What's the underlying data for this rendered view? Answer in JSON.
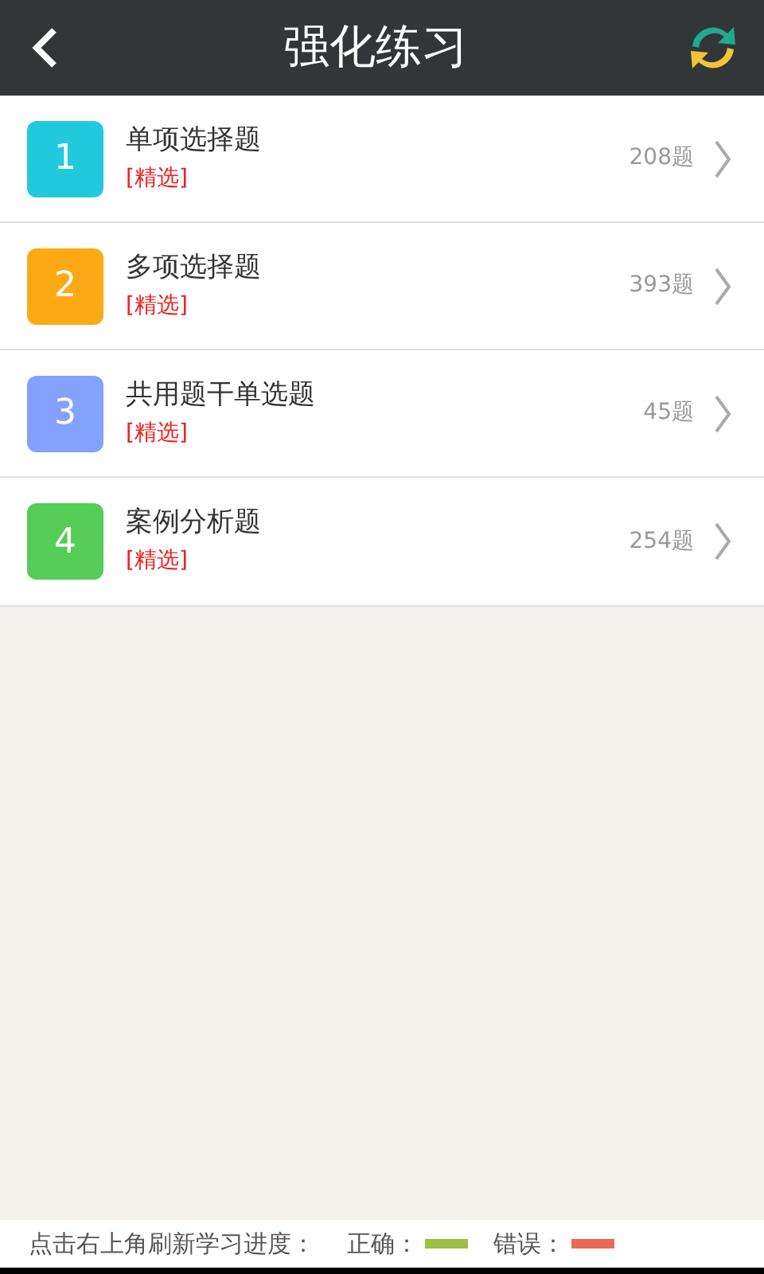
{
  "header": {
    "title": "强化练习"
  },
  "items": [
    {
      "number": "1",
      "title": "单项选择题",
      "tag": "[精选]",
      "count": "208题",
      "color": "#22c9dd"
    },
    {
      "number": "2",
      "title": "多项选择题",
      "tag": "[精选]",
      "count": "393题",
      "color": "#fda915"
    },
    {
      "number": "3",
      "title": "共用题干单选题",
      "tag": "[精选]",
      "count": "45题",
      "color": "#84a1fe"
    },
    {
      "number": "4",
      "title": "案例分析题",
      "tag": "[精选]",
      "count": "254题",
      "color": "#55cd57"
    }
  ],
  "footer": {
    "hint": "点击右上角刷新学习进度：",
    "legend": [
      {
        "label": "正确：",
        "color": "#9dc043"
      },
      {
        "label": "错误：",
        "color": "#e96a51"
      }
    ]
  }
}
